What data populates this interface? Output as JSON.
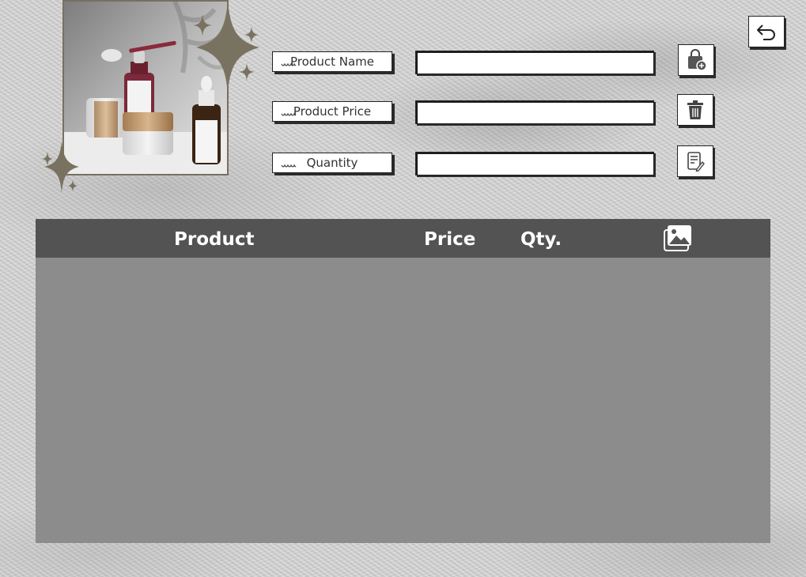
{
  "form": {
    "product_name": {
      "label": "Product Name",
      "value": ""
    },
    "product_price": {
      "label": "Product Price",
      "value": ""
    },
    "quantity": {
      "label": "Quantity",
      "value": ""
    }
  },
  "actions": {
    "add_icon": "shopping-bag-add-icon",
    "delete_icon": "trash-icon",
    "edit_icon": "edit-document-icon",
    "back_icon": "undo-arrow-icon"
  },
  "table": {
    "columns": [
      "Product",
      "Price",
      "Qty."
    ],
    "image_column_icon": "image-icon",
    "rows": []
  },
  "colors": {
    "header_bg": "#535353",
    "body_bg": "#8c8c8c",
    "sparkle": "#7a7260",
    "accent_wine": "#7a2a3a"
  }
}
